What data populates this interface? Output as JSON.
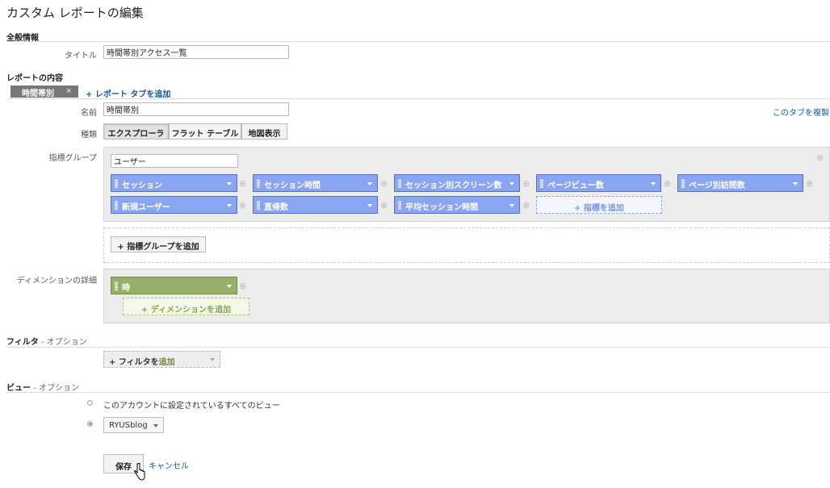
{
  "page": {
    "title": "カスタム レポートの編集"
  },
  "general": {
    "heading": "全般情報",
    "title_label": "タイトル",
    "title_value": "時間帯別アクセス一覧"
  },
  "content": {
    "heading": "レポートの内容",
    "tab_label": "時間帯別",
    "tab_close": "×",
    "add_tab": "+ レポート タブを追加",
    "name_label": "名前",
    "name_value": "時間帯別",
    "copy_tab": "このタブを複製",
    "type_label": "種類",
    "types": [
      "エクスプローラ",
      "フラット テーブル",
      "地図表示"
    ],
    "selected_type": "エクスプローラ",
    "metric_group_label": "指標グループ",
    "metric_group_name": "ユーザー",
    "metrics": [
      "セッション",
      "セッション時間",
      "セッション別スクリーン数",
      "ページビュー数",
      "ページ別訪問数",
      "新規ユーザー",
      "直帰数",
      "平均セッション時間"
    ],
    "add_metric": "+ 指標を追加",
    "add_metric_group": "+ 指標グループを追加",
    "dimension_label": "ディメンションの詳細",
    "dimension": "時",
    "add_dimension": "+ ディメンションを追加"
  },
  "filter": {
    "heading": "フィルタ",
    "optional": " - オプション",
    "add_filter_prefix": "+ フィルタを",
    "add_filter_suffix": "追加"
  },
  "view": {
    "heading": "ビュー",
    "optional": " - オプション",
    "all_views": "このアカウントに設定されているすべてのビュー",
    "selected_view": "RYUSblog"
  },
  "actions": {
    "save": "保存",
    "cancel": "キャンセル"
  },
  "colors": {
    "metric_chip": "#8aa5f2",
    "dimension_chip": "#96b06a",
    "link": "#15589a"
  }
}
